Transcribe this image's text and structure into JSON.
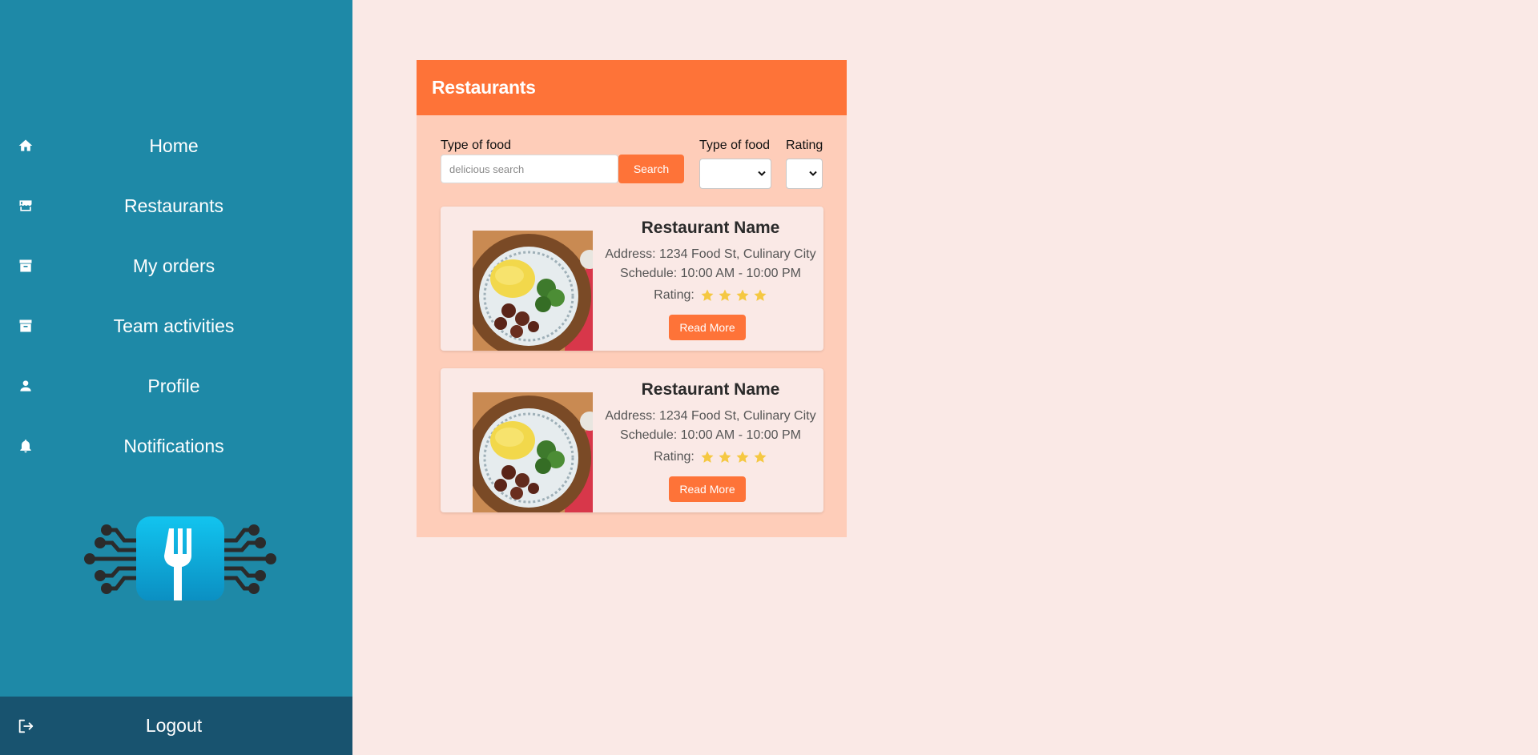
{
  "sidebar": {
    "items": [
      {
        "label": "Home",
        "icon": "home-icon"
      },
      {
        "label": "Restaurants",
        "icon": "storefront-icon"
      },
      {
        "label": "My orders",
        "icon": "archive-icon"
      },
      {
        "label": "Team activities",
        "icon": "archive-icon"
      },
      {
        "label": "Profile",
        "icon": "person-icon"
      },
      {
        "label": "Notifications",
        "icon": "bell-icon"
      }
    ],
    "logout_label": "Logout",
    "background": "#1e89a7",
    "logout_background": "#18536f"
  },
  "panel": {
    "title": "Restaurants",
    "header_color": "#fe7338",
    "filters": {
      "search_label": "Type of food",
      "search_placeholder": "delicious search",
      "search_button": "Search",
      "type_label": "Type of food",
      "type_selected": "",
      "rating_label": "Rating",
      "rating_selected": ""
    },
    "restaurants": [
      {
        "name": "Restaurant Name",
        "address": "Address: 1234 Food St, Culinary City",
        "schedule": "Schedule: 10:00 AM - 10:00 PM",
        "rating_label": "Rating:",
        "rating": 4,
        "read_more": "Read More"
      },
      {
        "name": "Restaurant Name",
        "address": "Address: 1234 Food St, Culinary City",
        "schedule": "Schedule: 10:00 AM - 10:00 PM",
        "rating_label": "Rating:",
        "rating": 4,
        "read_more": "Read More"
      }
    ]
  }
}
